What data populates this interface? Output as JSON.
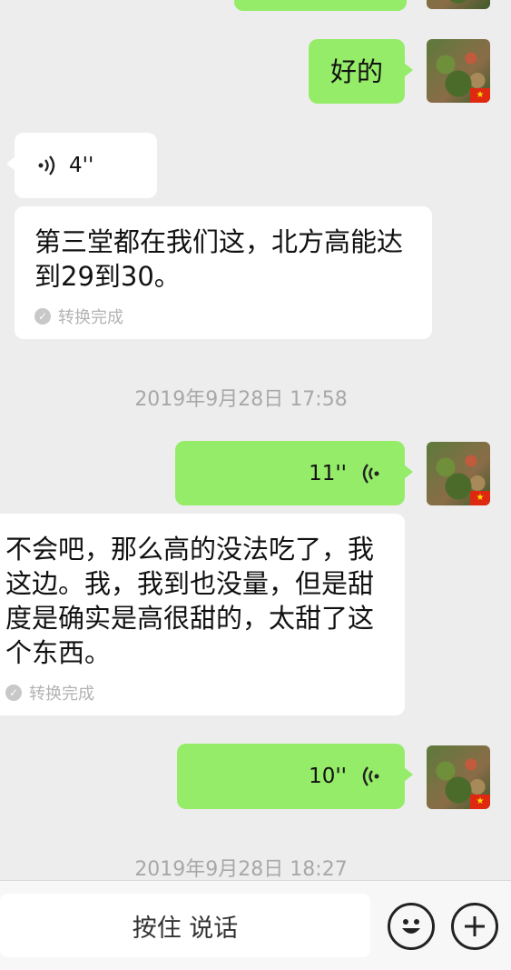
{
  "messages": {
    "m1_text": "好的",
    "m2_voice_len": "4''",
    "m3_text": "第三堂都在我们这，北方高能达到29到30。",
    "m3_status": "转换完成",
    "timestamp1": "2019年9月28日 17:58",
    "m4_voice_len": "11''",
    "m5_text": "不会吧，那么高的没法吃了，我这边。我，我到也没量，但是甜度是确实是高很甜的，太甜了这个东西。",
    "m5_status": "转换完成",
    "m6_voice_len": "10''",
    "timestamp2": "2019年9月28日 18:27"
  },
  "input_bar": {
    "hold_to_talk_label": "按住 说话"
  },
  "colors": {
    "sent_bubble": "#95ec69",
    "received_bubble": "#ffffff",
    "background": "#ededed"
  }
}
